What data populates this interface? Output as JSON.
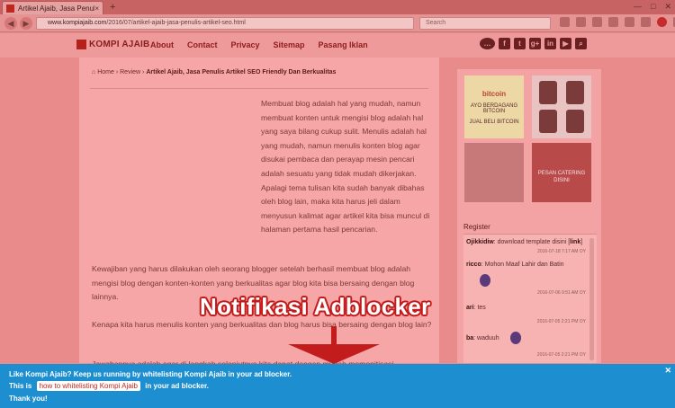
{
  "browser": {
    "tab_title": "Artikel Ajaib, Jasa Penulis A...",
    "tab_close": "×",
    "new_tab": "+",
    "url_host": "www.kompiajaib.com",
    "url_path": "/2016/07/artikel-ajaib-jasa-penulis-artikel-seo.html",
    "search_placeholder": "Search",
    "window_controls": [
      "—",
      "□",
      "✕"
    ]
  },
  "site": {
    "logo": "KOMPI AJAIB",
    "menu": [
      "About",
      "Contact",
      "Privacy",
      "Sitemap",
      "Pasang Iklan"
    ],
    "social_icons": [
      "chat-icon",
      "facebook-icon",
      "twitter-icon",
      "googleplus-icon",
      "linkedin-icon",
      "youtube-icon",
      "search-icon"
    ]
  },
  "breadcrumb": {
    "home": "Home",
    "sep1": "›",
    "review": "Review",
    "sep2": "›",
    "current": "Artikel Ajaib, Jasa Penulis Artikel SEO Friendly Dan Berkualitas"
  },
  "article": {
    "p1": "Membuat blog adalah hal yang mudah, namun membuat konten untuk mengisi blog adalah hal yang saya bilang cukup sulit. Menulis adalah hal yang mudah, namun menulis konten blog agar disukai pembaca dan perayap mesin pencari adalah sesuatu yang tidak mudah dikerjakan. Apalagi tema tulisan kita sudah banyak dibahas oleh blog lain, maka kita harus jeli dalam menyusun kalimat agar artikel kita bisa muncul di halaman pertama hasil pencarian.",
    "p2": "Kewajiban yang harus dilakukan oleh seorang blogger setelah berhasil membuat blog adalah mengisi blog dengan konten-konten yang berkualitas agar blog kita bisa bersaing dengan blog lainnya.",
    "p3": "Kenapa kita harus menulis konten yang berkualitas dan blog harus bisa bersaing dengan blog lain?",
    "p4": "Jawabannya adalah agar di langkah selanjutnya kita dapat dengan mudah memonitisasi"
  },
  "sidebar": {
    "ad1_brand": "bitcoin",
    "ad1_text": "AYO BERDAGANG BITCOIN",
    "ad1_cta": "JUAL BELI BITCOIN",
    "ad4_text": "PESAN CATERING DISINI",
    "widget_title": "Register",
    "messages": [
      {
        "user": "Ojikkidiw",
        "text": ": download template disini [",
        "link": "link",
        "end": "]",
        "meta": "2016-07-18 7:17 AM OY"
      },
      {
        "user": "ricco",
        "text": ": Mohon Maaf Lahir dan Batin",
        "link": "",
        "end": "",
        "meta": "2016-07-06 9:51 AM OY"
      },
      {
        "user": "ari",
        "text": ": tes",
        "link": "",
        "end": "",
        "meta": "2016-07-05 2:21 PM OY"
      },
      {
        "user": "ba",
        "text": ": waduuh",
        "link": "",
        "end": "",
        "meta": "2016-07-05 2:21 PM OY"
      }
    ]
  },
  "annotation": "Notifikasi Adblocker",
  "notification": {
    "line1": "Like Kompi Ajaib? Keep us running by whitelisting Kompi Ajaib in your ad blocker.",
    "line2_prefix": "This is",
    "line2_link": "how to whitelisting Kompi Ajaib",
    "line2_suffix": "in your ad blocker.",
    "line3": "Thank you!",
    "close": "✕"
  },
  "colors": {
    "overlay": "#e98b8b",
    "notification_bg": "#1d8fd1",
    "annotation_outline": "#c31c1c",
    "link": "#c1271f"
  }
}
